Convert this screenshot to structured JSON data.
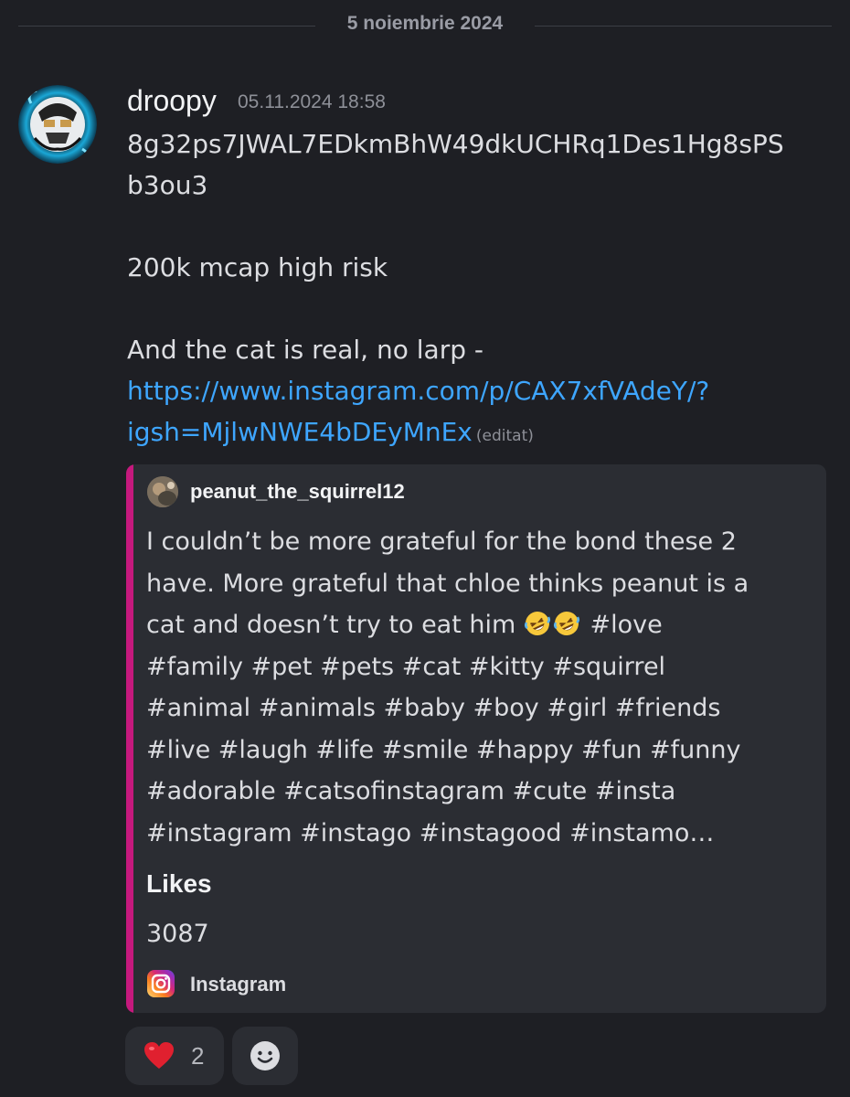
{
  "divider": {
    "date": "5 noiembrie 2024"
  },
  "message": {
    "author": "droopy",
    "timestamp": "05.11.2024 18:58",
    "lines": [
      "8g32ps7JWAL7EDkmBhW49dkUCHRq1Des1Hg8sPS",
      "b3ou3",
      "200k mcap high risk",
      "And the cat is real, no larp -"
    ],
    "link_lines": [
      "https://www.instagram.com/p/CAX7xfVAdeY/?",
      "igsh=MjlwNWE4bDEyMnEx"
    ],
    "edited_label": "(editat)"
  },
  "embed": {
    "accent_color": "#c5197d",
    "author": "peanut_the_squirrel12",
    "description_lines": [
      "I couldn’t be more grateful for the bond these 2",
      "have. More grateful that chloe thinks peanut is a",
      "cat and doesn’t try to eat him",
      "#love",
      "#family #pet #pets #cat #kitty #squirrel",
      "#animal #animals #baby #boy #girl #friends",
      "#live #laugh #life #smile #happy #fun #funny",
      "#adorable #catsofinstagram #cute #insta",
      "#instagram #instago #instagood #instamo…"
    ],
    "emojis": [
      "rolling-on-floor-laughing-emoji",
      "rolling-on-floor-laughing-emoji"
    ],
    "field_name": "Likes",
    "field_value": "3087",
    "footer": "Instagram",
    "footer_icon": "instagram-icon"
  },
  "reactions": [
    {
      "emoji": "red-heart-icon",
      "count": "2"
    }
  ],
  "add_reaction_icon": "add-reaction-smiley-icon"
}
